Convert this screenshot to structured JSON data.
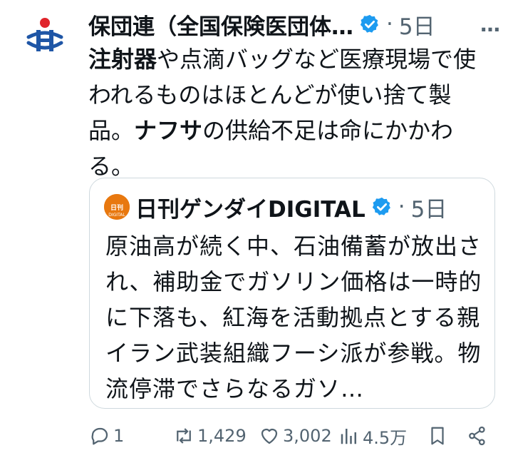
{
  "tweet": {
    "author": "保団連（全国保険医団体…",
    "separator": "·",
    "time": "5日",
    "more": "…",
    "text_segments": [
      {
        "text": "注射器",
        "bold": true
      },
      {
        "text": "や点滴バッグなど医療現場で使われるものはほとんどが使い捨て製品。",
        "bold": false
      },
      {
        "text": "ナフサ",
        "bold": true
      },
      {
        "text": "の供給不足は命にかかわる。",
        "bold": false
      }
    ]
  },
  "quote": {
    "author": "日刊ゲンダイDIGITAL",
    "separator": "·",
    "time": "5日",
    "text": "原油高が続く中、石油備蓄が放出され、補助金でガソリン価格は一時的に下落も、紅海を活動拠点とする親イラン武装組織フーシ派が参戦。物流停滞でさらなるガソ…",
    "avatar_text": "日刊ゲンダイ"
  },
  "actions": {
    "reply_count": "1",
    "retweet_count": "1,429",
    "like_count": "3,002",
    "view_count": "4.5万"
  },
  "colors": {
    "verified": "#1d9bf0",
    "muted": "#536471",
    "avatar_orange": "#e8780f",
    "logo_blue": "#1f56a6",
    "logo_red": "#e0242a"
  }
}
